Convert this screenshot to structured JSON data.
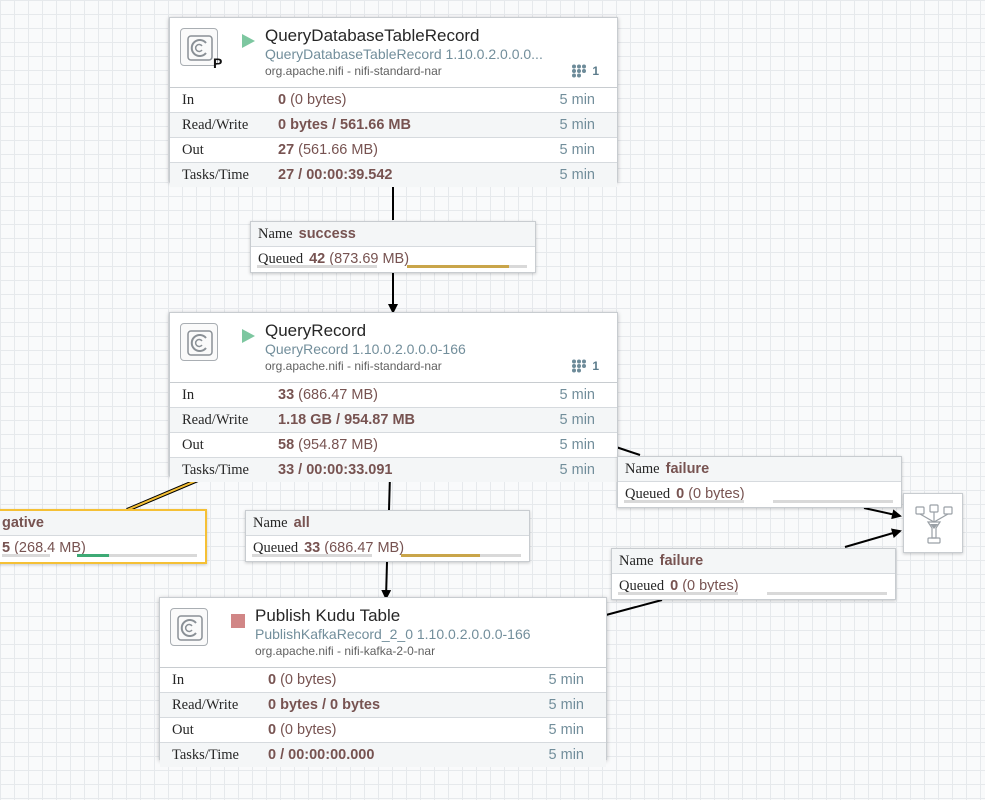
{
  "processors": [
    {
      "name": "QueryDatabaseTableRecord",
      "type": "QueryDatabaseTableRecord 1.10.0.2.0.0.0...",
      "bundle": "org.apache.nifi - nifi-standard-nar",
      "state": "running",
      "primary_badge": "P",
      "threads": "1",
      "stats": [
        {
          "label": "In",
          "value_bold": "0",
          "value_rest": " (0 bytes)",
          "time": "5 min"
        },
        {
          "label": "Read/Write",
          "value_bold": "0 bytes / 561.66 MB",
          "value_rest": "",
          "time": "5 min"
        },
        {
          "label": "Out",
          "value_bold": "27",
          "value_rest": " (561.66 MB)",
          "time": "5 min"
        },
        {
          "label": "Tasks/Time",
          "value_bold": "27 / 00:00:39.542",
          "value_rest": "",
          "time": "5 min"
        }
      ]
    },
    {
      "name": "QueryRecord",
      "type": "QueryRecord 1.10.0.2.0.0.0-166",
      "bundle": "org.apache.nifi - nifi-standard-nar",
      "state": "running",
      "primary_badge": "",
      "threads": "1",
      "stats": [
        {
          "label": "In",
          "value_bold": "33",
          "value_rest": " (686.47 MB)",
          "time": "5 min"
        },
        {
          "label": "Read/Write",
          "value_bold": "1.18 GB / 954.87 MB",
          "value_rest": "",
          "time": "5 min"
        },
        {
          "label": "Out",
          "value_bold": "58",
          "value_rest": " (954.87 MB)",
          "time": "5 min"
        },
        {
          "label": "Tasks/Time",
          "value_bold": "33 / 00:00:33.091",
          "value_rest": "",
          "time": "5 min"
        }
      ]
    },
    {
      "name": "Publish Kudu Table",
      "type": "PublishKafkaRecord_2_0 1.10.0.2.0.0.0-166",
      "bundle": "org.apache.nifi - nifi-kafka-2-0-nar",
      "state": "stopped",
      "primary_badge": "",
      "threads": "",
      "stats": [
        {
          "label": "In",
          "value_bold": "0",
          "value_rest": " (0 bytes)",
          "time": "5 min"
        },
        {
          "label": "Read/Write",
          "value_bold": "0 bytes / 0 bytes",
          "value_rest": "",
          "time": "5 min"
        },
        {
          "label": "Out",
          "value_bold": "0",
          "value_rest": " (0 bytes)",
          "time": "5 min"
        },
        {
          "label": "Tasks/Time",
          "value_bold": "0 / 00:00:00.000",
          "value_rest": "",
          "time": "5 min"
        }
      ]
    }
  ],
  "connections": [
    {
      "name_label": "Name",
      "name": "success",
      "queued_label": "Queued",
      "count": "42",
      "size": " (873.69 MB)",
      "fill_fraction": 0.85,
      "fill_color": "#c9a54a"
    },
    {
      "name_label": "Name",
      "name": "all",
      "queued_label": "Queued",
      "count": "33",
      "size": " (686.47 MB)",
      "fill_fraction": 0.66,
      "fill_color": "#c9a54a"
    },
    {
      "name_label": "Name",
      "name": "failure",
      "queued_label": "Queued",
      "count": "0",
      "size": " (0 bytes)",
      "fill_fraction": 0,
      "fill_color": "#c9a54a"
    },
    {
      "name_label": "Name",
      "name": "failure",
      "queued_label": "Queued",
      "count": "0",
      "size": " (0 bytes)",
      "fill_fraction": 0,
      "fill_color": "#c9a54a"
    },
    {
      "name_partial": "gative",
      "count_partial": "5",
      "size": " (268.4 MB)",
      "fill_fraction": 0.25,
      "fill_color": "#3daa75"
    }
  ],
  "colors": {
    "running": "#7dc7a0",
    "stopped": "#d18686",
    "selected_border": "#f5c035",
    "bend_point": "#ff0000"
  },
  "icons": [
    "processor-icon",
    "play-icon",
    "stop-icon",
    "threads-icon",
    "funnel-icon"
  ]
}
